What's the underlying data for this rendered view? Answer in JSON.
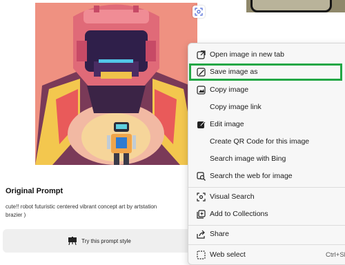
{
  "prompt": {
    "title": "Original Prompt",
    "text_line1": "cute!! robot futuristic centered vibrant concept art by artstation",
    "text_line2": "brazier )",
    "try_button_label": "Try this prompt style"
  },
  "context_menu": {
    "items": [
      {
        "label": "Open image in new tab",
        "icon": "open-in-new-tab-icon"
      },
      {
        "label": "Save image as",
        "icon": "save-image-icon",
        "highlighted": true
      },
      {
        "label": "Copy image",
        "icon": "copy-image-icon"
      },
      {
        "label": "Copy image link",
        "icon": ""
      },
      {
        "label": "Edit image",
        "icon": "edit-image-icon"
      },
      {
        "label": "Create QR Code for this image",
        "icon": ""
      },
      {
        "label": "Search image with Bing",
        "icon": ""
      },
      {
        "label": "Search the web for image",
        "icon": "search-web-image-icon"
      },
      {
        "label": "Visual Search",
        "icon": "visual-search-icon"
      },
      {
        "label": "Add to Collections",
        "icon": "collections-icon"
      },
      {
        "label": "Share",
        "icon": "share-icon"
      },
      {
        "label": "Web select",
        "icon": "web-select-icon",
        "shortcut": "Ctrl+Sh"
      }
    ]
  },
  "colors": {
    "highlight_border": "#22a745",
    "art_background": "#ef9181"
  }
}
